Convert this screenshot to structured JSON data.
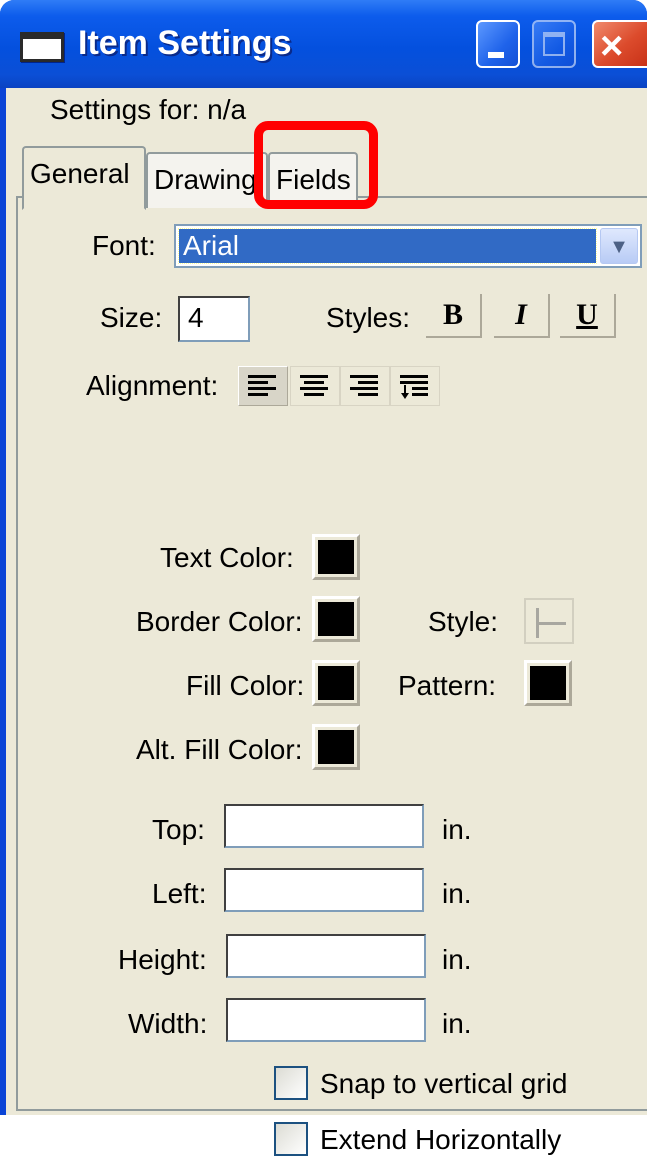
{
  "window": {
    "title": "Item Settings",
    "minimize_label": "",
    "maximize_label": "",
    "close_label": "×"
  },
  "header": {
    "settings_for": "Settings for:  n/a"
  },
  "tabs": [
    {
      "label": "General",
      "selected": true
    },
    {
      "label": "Drawing",
      "selected": false
    },
    {
      "label": "Fields",
      "selected": false
    }
  ],
  "font": {
    "label": "Font:",
    "value": "Arial",
    "dropdown_glyph": "▼"
  },
  "size": {
    "label": "Size:",
    "value": "4"
  },
  "styles": {
    "label": "Styles:",
    "bold": "B",
    "italic": "I",
    "underline": "U"
  },
  "alignment": {
    "label": "Alignment:",
    "selected": "left"
  },
  "colors": {
    "text_color_label": "Text Color:",
    "border_color_label": "Border Color:",
    "fill_color_label": "Fill Color:",
    "alt_fill_color_label": "Alt. Fill Color:",
    "style_label": "Style:",
    "pattern_label": "Pattern:",
    "swatch_color": "#000000"
  },
  "dimensions": {
    "top_label": "Top:",
    "left_label": "Left:",
    "height_label": "Height:",
    "width_label": "Width:",
    "unit": "in.",
    "top_value": "",
    "left_value": "",
    "height_value": "",
    "width_value": ""
  },
  "options": {
    "snap_label": "Snap to vertical grid",
    "extend_label": "Extend Horizontally",
    "snap_checked": false,
    "extend_checked": false
  },
  "annotation": {
    "highlight_color": "#ff0000",
    "highlighted_tab": "Fields"
  }
}
